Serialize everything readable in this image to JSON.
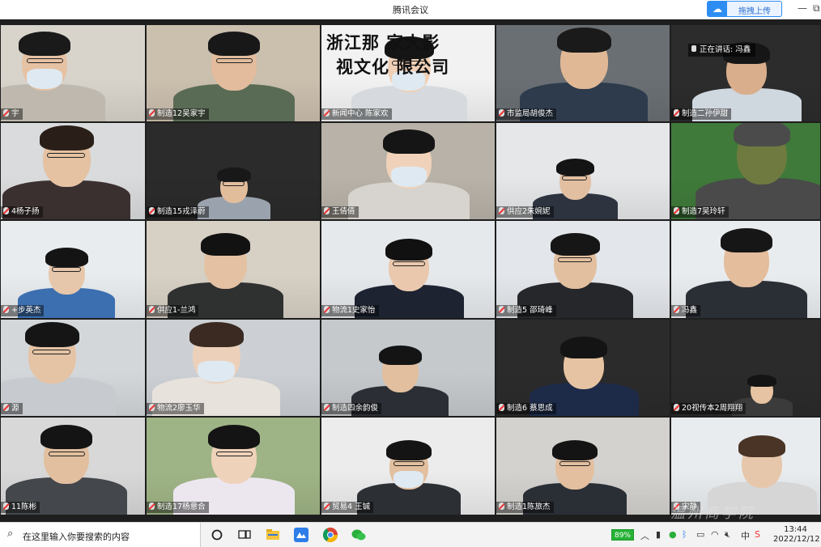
{
  "window": {
    "title": "腾讯会议",
    "upload_button": "拖拽上传",
    "minimize": "—",
    "restore": "⧉"
  },
  "speaking_indicator": "正在讲话: 冯鑫",
  "banner_line1": "浙江那 家大影",
  "banner_line2": "视文化 限公司",
  "participants": [
    "宇",
    "制造12吴家宇",
    "新闻中心 陈家欢",
    "市监局胡俊杰",
    "制造二孙伊甜",
    "4杨子扬",
    "制造15戎泽蔚",
    "王倩倩",
    "供应2朱婉妮",
    "制造7吴玲轩",
    "+步英杰",
    "供应1-兰鸿",
    "物流1史家怡",
    "制造5 邵琦峰",
    "冯鑫",
    "源",
    "物流2廖玉华",
    "制造四余韵俊",
    "制造6 蔡思成",
    "20视传本2周翔翔",
    "11陈彬",
    "制造17杨意合",
    "贸易4 王铖",
    "制造1陈旅杰",
    "宋静"
  ],
  "watermark": "温州商学院",
  "taskbar": {
    "search_placeholder": "在这里输入你要搜索的内容",
    "battery": "89%",
    "time": "13:44",
    "date": "2022/12/12",
    "tray_icons": [
      "chevron-up-icon",
      "mic-icon",
      "wechat-tray-icon",
      "bluetooth-icon",
      "battery-icon",
      "wifi-icon",
      "volume-mute-icon",
      "ime-icon",
      "sogou-icon"
    ]
  }
}
